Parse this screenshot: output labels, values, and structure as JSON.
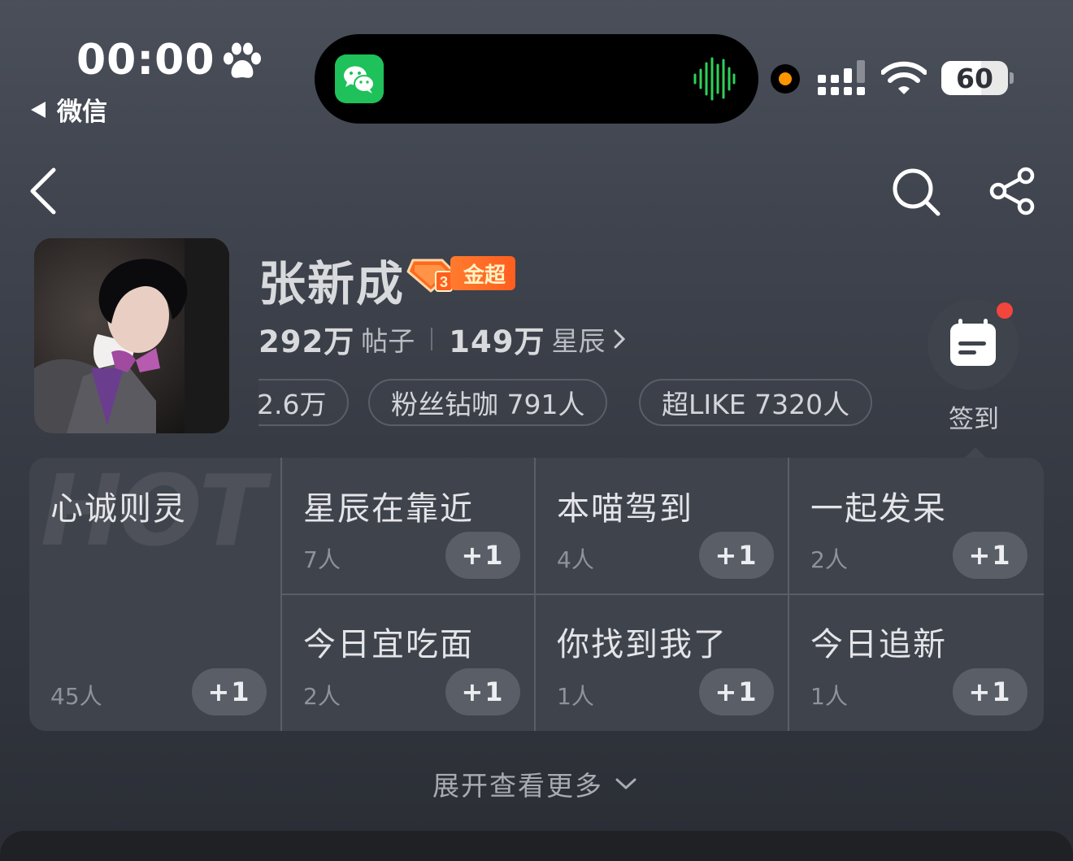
{
  "status_bar": {
    "time": "00:00",
    "back_app": "微信",
    "battery": "60",
    "battery_level": 0.6
  },
  "profile": {
    "name": "张新成",
    "badge_level": "3",
    "badge_label": "金超",
    "posts_count": "292万",
    "posts_label": "帖子",
    "stars_count": "149万",
    "stars_label": "星辰",
    "chips": [
      "2.6万",
      "粉丝钻咖 791人",
      "超LIKE 7320人"
    ],
    "checkin_label": "签到"
  },
  "grid": {
    "watermark": "HOT",
    "featured": {
      "title": "心诚则灵",
      "count": "45人",
      "plus": "+1"
    },
    "cells": [
      {
        "title": "星辰在靠近",
        "count": "7人",
        "plus": "+1"
      },
      {
        "title": "本喵驾到",
        "count": "4人",
        "plus": "+1"
      },
      {
        "title": "一起发呆",
        "count": "2人",
        "plus": "+1"
      },
      {
        "title": "今日宜吃面",
        "count": "2人",
        "plus": "+1"
      },
      {
        "title": "你找到我了",
        "count": "1人",
        "plus": "+1"
      },
      {
        "title": "今日追新",
        "count": "1人",
        "plus": "+1"
      }
    ]
  },
  "expand_label": "展开查看更多",
  "colors": {
    "background": "#3f444e",
    "badge_orange": "#ff5e1f",
    "wechat_green": "#1fc15a",
    "recording_dot": "#ff9500",
    "notification_dot": "#f2453d"
  }
}
